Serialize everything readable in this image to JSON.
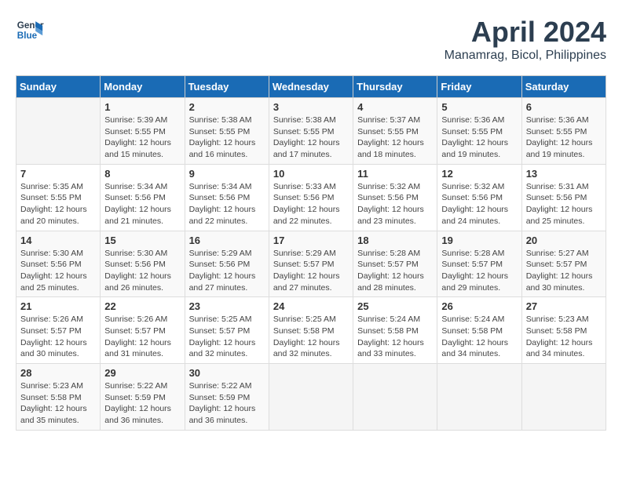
{
  "header": {
    "logo_line1": "General",
    "logo_line2": "Blue",
    "title": "April 2024",
    "subtitle": "Manamrag, Bicol, Philippines"
  },
  "days_of_week": [
    "Sunday",
    "Monday",
    "Tuesday",
    "Wednesday",
    "Thursday",
    "Friday",
    "Saturday"
  ],
  "weeks": [
    [
      {
        "num": "",
        "detail": ""
      },
      {
        "num": "1",
        "detail": "Sunrise: 5:39 AM\nSunset: 5:55 PM\nDaylight: 12 hours\nand 15 minutes."
      },
      {
        "num": "2",
        "detail": "Sunrise: 5:38 AM\nSunset: 5:55 PM\nDaylight: 12 hours\nand 16 minutes."
      },
      {
        "num": "3",
        "detail": "Sunrise: 5:38 AM\nSunset: 5:55 PM\nDaylight: 12 hours\nand 17 minutes."
      },
      {
        "num": "4",
        "detail": "Sunrise: 5:37 AM\nSunset: 5:55 PM\nDaylight: 12 hours\nand 18 minutes."
      },
      {
        "num": "5",
        "detail": "Sunrise: 5:36 AM\nSunset: 5:55 PM\nDaylight: 12 hours\nand 19 minutes."
      },
      {
        "num": "6",
        "detail": "Sunrise: 5:36 AM\nSunset: 5:55 PM\nDaylight: 12 hours\nand 19 minutes."
      }
    ],
    [
      {
        "num": "7",
        "detail": "Sunrise: 5:35 AM\nSunset: 5:55 PM\nDaylight: 12 hours\nand 20 minutes."
      },
      {
        "num": "8",
        "detail": "Sunrise: 5:34 AM\nSunset: 5:56 PM\nDaylight: 12 hours\nand 21 minutes."
      },
      {
        "num": "9",
        "detail": "Sunrise: 5:34 AM\nSunset: 5:56 PM\nDaylight: 12 hours\nand 22 minutes."
      },
      {
        "num": "10",
        "detail": "Sunrise: 5:33 AM\nSunset: 5:56 PM\nDaylight: 12 hours\nand 22 minutes."
      },
      {
        "num": "11",
        "detail": "Sunrise: 5:32 AM\nSunset: 5:56 PM\nDaylight: 12 hours\nand 23 minutes."
      },
      {
        "num": "12",
        "detail": "Sunrise: 5:32 AM\nSunset: 5:56 PM\nDaylight: 12 hours\nand 24 minutes."
      },
      {
        "num": "13",
        "detail": "Sunrise: 5:31 AM\nSunset: 5:56 PM\nDaylight: 12 hours\nand 25 minutes."
      }
    ],
    [
      {
        "num": "14",
        "detail": "Sunrise: 5:30 AM\nSunset: 5:56 PM\nDaylight: 12 hours\nand 25 minutes."
      },
      {
        "num": "15",
        "detail": "Sunrise: 5:30 AM\nSunset: 5:56 PM\nDaylight: 12 hours\nand 26 minutes."
      },
      {
        "num": "16",
        "detail": "Sunrise: 5:29 AM\nSunset: 5:56 PM\nDaylight: 12 hours\nand 27 minutes."
      },
      {
        "num": "17",
        "detail": "Sunrise: 5:29 AM\nSunset: 5:57 PM\nDaylight: 12 hours\nand 27 minutes."
      },
      {
        "num": "18",
        "detail": "Sunrise: 5:28 AM\nSunset: 5:57 PM\nDaylight: 12 hours\nand 28 minutes."
      },
      {
        "num": "19",
        "detail": "Sunrise: 5:28 AM\nSunset: 5:57 PM\nDaylight: 12 hours\nand 29 minutes."
      },
      {
        "num": "20",
        "detail": "Sunrise: 5:27 AM\nSunset: 5:57 PM\nDaylight: 12 hours\nand 30 minutes."
      }
    ],
    [
      {
        "num": "21",
        "detail": "Sunrise: 5:26 AM\nSunset: 5:57 PM\nDaylight: 12 hours\nand 30 minutes."
      },
      {
        "num": "22",
        "detail": "Sunrise: 5:26 AM\nSunset: 5:57 PM\nDaylight: 12 hours\nand 31 minutes."
      },
      {
        "num": "23",
        "detail": "Sunrise: 5:25 AM\nSunset: 5:57 PM\nDaylight: 12 hours\nand 32 minutes."
      },
      {
        "num": "24",
        "detail": "Sunrise: 5:25 AM\nSunset: 5:58 PM\nDaylight: 12 hours\nand 32 minutes."
      },
      {
        "num": "25",
        "detail": "Sunrise: 5:24 AM\nSunset: 5:58 PM\nDaylight: 12 hours\nand 33 minutes."
      },
      {
        "num": "26",
        "detail": "Sunrise: 5:24 AM\nSunset: 5:58 PM\nDaylight: 12 hours\nand 34 minutes."
      },
      {
        "num": "27",
        "detail": "Sunrise: 5:23 AM\nSunset: 5:58 PM\nDaylight: 12 hours\nand 34 minutes."
      }
    ],
    [
      {
        "num": "28",
        "detail": "Sunrise: 5:23 AM\nSunset: 5:58 PM\nDaylight: 12 hours\nand 35 minutes."
      },
      {
        "num": "29",
        "detail": "Sunrise: 5:22 AM\nSunset: 5:59 PM\nDaylight: 12 hours\nand 36 minutes."
      },
      {
        "num": "30",
        "detail": "Sunrise: 5:22 AM\nSunset: 5:59 PM\nDaylight: 12 hours\nand 36 minutes."
      },
      {
        "num": "",
        "detail": ""
      },
      {
        "num": "",
        "detail": ""
      },
      {
        "num": "",
        "detail": ""
      },
      {
        "num": "",
        "detail": ""
      }
    ]
  ]
}
